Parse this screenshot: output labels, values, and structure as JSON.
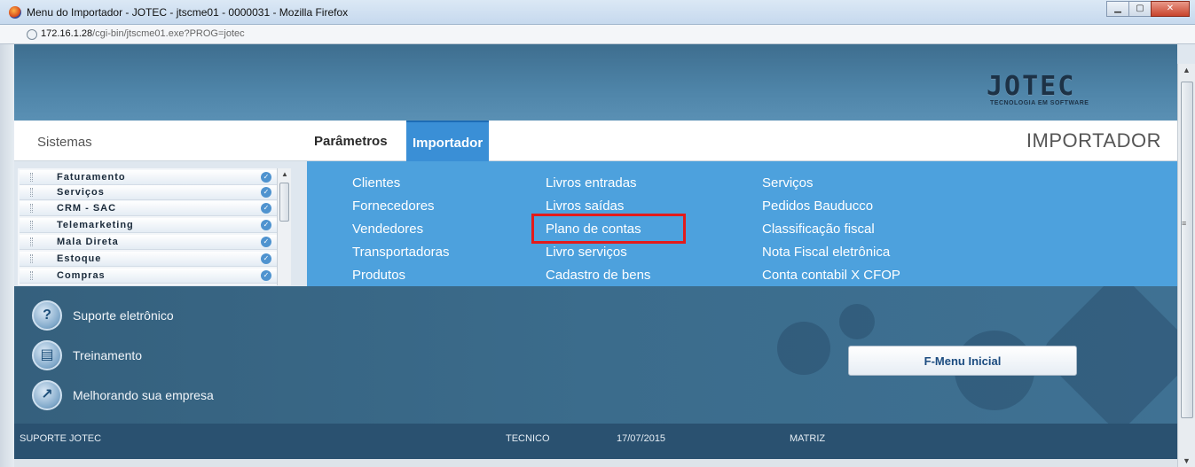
{
  "window": {
    "title": "Menu do Importador - JOTEC - jtscme01 - 0000031 - Mozilla Firefox",
    "url_host": "172.16.1.28",
    "url_path": "/cgi-bin/jtscme01.exe?PROG=jotec",
    "buttons": [
      "minimize",
      "maximize",
      "close"
    ]
  },
  "header": {
    "logo_word": "JOTEC",
    "logo_tagline": "TECNOLOGIA EM SOFTWARE"
  },
  "tabs_row": {
    "sistemas_label": "Sistemas",
    "tabs": [
      {
        "label": "Parâmetros",
        "active": false
      },
      {
        "label": "Importador",
        "active": true
      }
    ],
    "page_title": "IMPORTADOR"
  },
  "systems": [
    {
      "label": "Faturamento"
    },
    {
      "label": "Serviços"
    },
    {
      "label": "CRM - SAC"
    },
    {
      "label": "Telemarketing"
    },
    {
      "label": "Mala Direta"
    },
    {
      "label": "Estoque"
    },
    {
      "label": "Compras"
    }
  ],
  "menu": {
    "columns": [
      [
        "Clientes",
        "Fornecedores",
        "Vendedores",
        "Transportadoras",
        "Produtos"
      ],
      [
        "Livros entradas",
        "Livros saídas",
        "Plano de contas",
        "Livro serviços",
        "Cadastro de bens"
      ],
      [
        "Serviços",
        "Pedidos Bauducco",
        "Classificação fiscal",
        "Nota Fiscal eletrônica",
        "Conta contabil X CFOP"
      ]
    ],
    "highlighted_item": "Plano de contas",
    "highlight_color": "#e31b1b"
  },
  "links": [
    {
      "label": "Suporte eletrônico",
      "icon": "question-icon"
    },
    {
      "label": "Treinamento",
      "icon": "e-learning-icon"
    },
    {
      "label": "Melhorando sua empresa",
      "icon": "growth-chart-icon"
    }
  ],
  "home_button": {
    "label": "F-Menu Inicial"
  },
  "footer": {
    "support": "SUPORTE JOTEC",
    "user": "TECNICO",
    "date": "17/07/2015",
    "branch": "MATRIZ"
  },
  "colors": {
    "menu_blue": "#4da1dd",
    "active_tab": "#3a8fd6",
    "lower_band": "#3b6c8c",
    "footer": "#2a5170"
  }
}
